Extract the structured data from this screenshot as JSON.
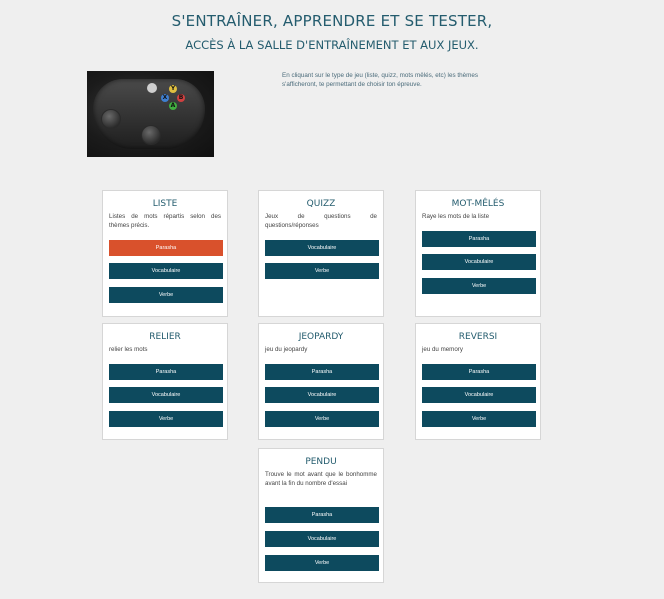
{
  "header": {
    "title": "S'ENTRAÎNER, APPRENDRE ET SE TESTER,",
    "subtitle": "ACCÈS À LA SALLE D'ENTRAÎNEMENT ET AUX JEUX."
  },
  "intro": {
    "text": "En cliquant sur le type de jeu (liste, quizz, mots mêlés, etc) les thèmes s'afficheront, te permettant de choisir ton épreuve.",
    "image_label": "controller-image"
  },
  "colors": {
    "accent": "#d9512c",
    "button": "#0d4a5e",
    "title": "#245c6e",
    "background": "#efefef"
  },
  "cards": [
    {
      "title": "LISTE",
      "description": "Listes de mots répartis selon des thèmes précis.",
      "buttons": [
        "Parasha",
        "Vocabulaire",
        "Verbe"
      ],
      "active_index": 0
    },
    {
      "title": "QUIZZ",
      "description": "Jeux de questions de questions/réponses",
      "buttons": [
        "Vocabulaire",
        "Verbe"
      ],
      "active_index": -1
    },
    {
      "title": "MOT-MÊLÉS",
      "description": "Raye les mots de la liste",
      "buttons": [
        "Parasha",
        "Vocabulaire",
        "Verbe"
      ],
      "active_index": -1
    },
    {
      "title": "RELIER",
      "description": "relier les mots",
      "buttons": [
        "Parasha",
        "Vocabulaire",
        "Verbe"
      ],
      "active_index": -1
    },
    {
      "title": "JEOPARDY",
      "description": "jeu du jeopardy",
      "buttons": [
        "Parasha",
        "Vocabulaire",
        "Verbe"
      ],
      "active_index": -1
    },
    {
      "title": "REVERSI",
      "description": "jeu du memory",
      "buttons": [
        "Parasha",
        "Vocabulaire",
        "Verbe"
      ],
      "active_index": -1
    },
    {
      "title": "PENDU",
      "description": "Trouve le mot avant que le bonhomme avant la fin du nombre d'essai",
      "buttons": [
        "Parasha",
        "Vocabulaire",
        "Verbe"
      ],
      "active_index": -1
    }
  ]
}
